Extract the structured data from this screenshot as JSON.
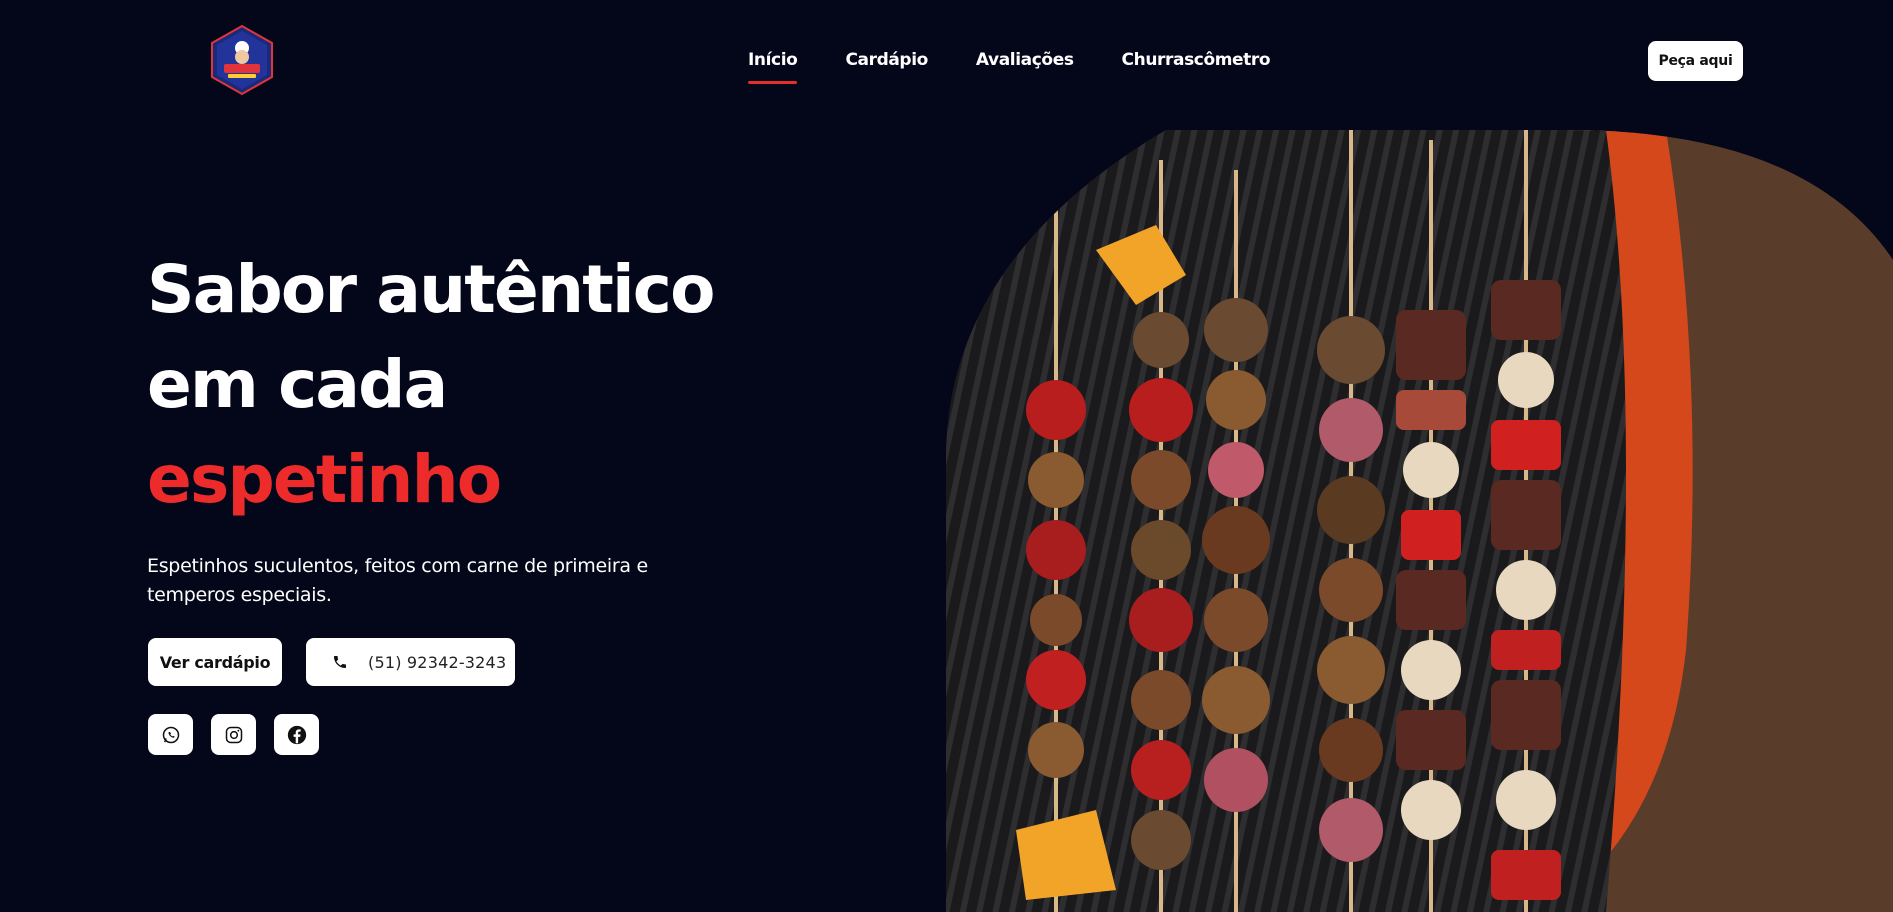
{
  "header": {
    "nav": [
      {
        "label": "Início",
        "active": true
      },
      {
        "label": "Cardápio",
        "active": false
      },
      {
        "label": "Avaliações",
        "active": false
      },
      {
        "label": "Churrascômetro",
        "active": false
      }
    ],
    "order_label": "Peça aqui"
  },
  "hero": {
    "title_line1": "Sabor autêntico",
    "title_line2": "em cada",
    "title_accent": "espetinho",
    "subtitle": "Espetinhos suculentos, feitos com carne de primeira e temperos especiais.",
    "menu_button": "Ver cardápio",
    "phone": "(51) 92342-3243",
    "social": [
      {
        "name": "whatsapp-icon"
      },
      {
        "name": "instagram-icon"
      },
      {
        "name": "facebook-icon"
      }
    ]
  },
  "colors": {
    "background": "#04061a",
    "accent": "#ee2b2b",
    "button": "#ffffff"
  }
}
